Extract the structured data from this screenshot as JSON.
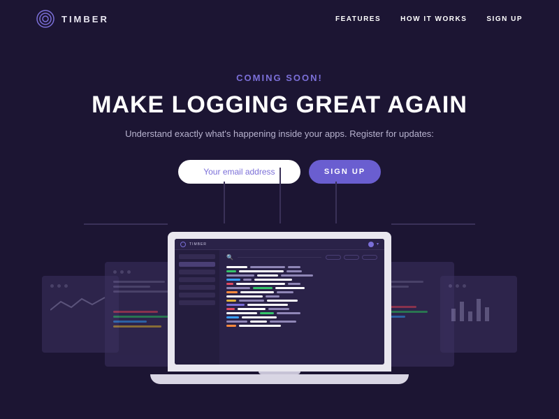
{
  "brand": {
    "name": "TIMBER"
  },
  "nav": {
    "features": "FEATURES",
    "how": "HOW IT WORKS",
    "signup": "SIGN UP"
  },
  "hero": {
    "eyebrow": "COMING SOON!",
    "headline": "MAKE LOGGING GREAT AGAIN",
    "sub": "Understand exactly what's happening inside your apps. Register for updates:",
    "email_placeholder": "Your email address",
    "signup_label": "SIGN UP"
  },
  "laptop_app": {
    "brand": "TIMBER"
  },
  "colors": {
    "accent": "#6a5ed0",
    "log_colors": [
      "#ffffff",
      "#35c46a",
      "#e0b33a",
      "#3aa0ff",
      "#e24a63",
      "#7b6fd8",
      "#ff8a3d"
    ]
  }
}
